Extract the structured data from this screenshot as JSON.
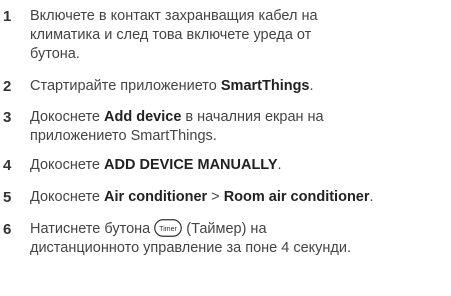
{
  "steps": [
    {
      "number": "1",
      "lines": [
        "Включете в контакт захранващия кабел на",
        "климатика и след това включете уреда от",
        "бутона."
      ]
    },
    {
      "number": "2",
      "pre": "Стартирайте приложението ",
      "bold": "SmartThings",
      "post": "."
    },
    {
      "number": "3",
      "l1_pre": "Докоснете ",
      "l1_bold": "Add device",
      "l1_post": " в началния екран на",
      "l2": "приложението SmartThings."
    },
    {
      "number": "4",
      "pre": "Докоснете ",
      "bold": "ADD DEVICE MANUALLY",
      "post": "."
    },
    {
      "number": "5",
      "pre": "Докоснете ",
      "bold1": "Air conditioner",
      "sep": " > ",
      "bold2": "Room air conditioner",
      "post": "."
    },
    {
      "number": "6",
      "pre": "Натиснете бутона ",
      "icon_label": "Timer",
      "icon": "timer-button-icon",
      "post": " (Таймер) на",
      "l2": "дистанционното управление за поне 4 секунди."
    }
  ]
}
